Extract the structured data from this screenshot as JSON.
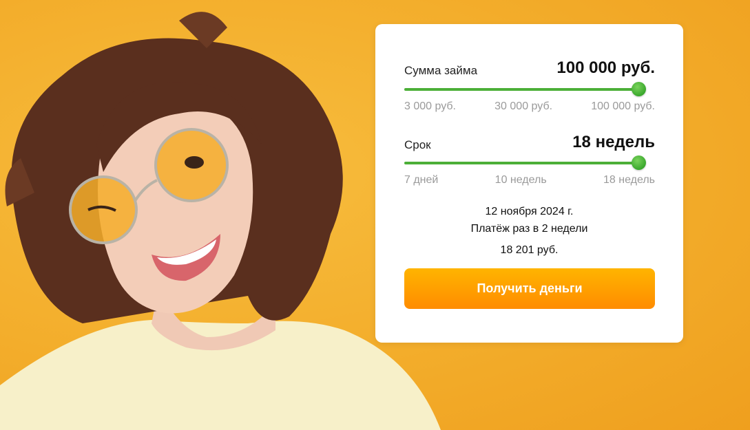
{
  "loan": {
    "amount_label": "Сумма займа",
    "amount_value": "100 000 руб.",
    "amount_fraction": 1.0,
    "amount_ticks": [
      "3 000 руб.",
      "30 000 руб.",
      "100 000 руб."
    ],
    "term_label": "Срок",
    "term_value": "18 недель",
    "term_fraction": 1.0,
    "term_ticks": [
      "7 дней",
      "10 недель",
      "18 недель"
    ]
  },
  "summary": {
    "date": "12 ноября 2024 г.",
    "schedule": "Платёж раз в 2 недели",
    "payment": "18 201 руб."
  },
  "cta": {
    "label": "Получить деньги"
  },
  "colors": {
    "accent": "#4caf38",
    "button": "#ff9a00",
    "background": "#f2ac2a"
  }
}
